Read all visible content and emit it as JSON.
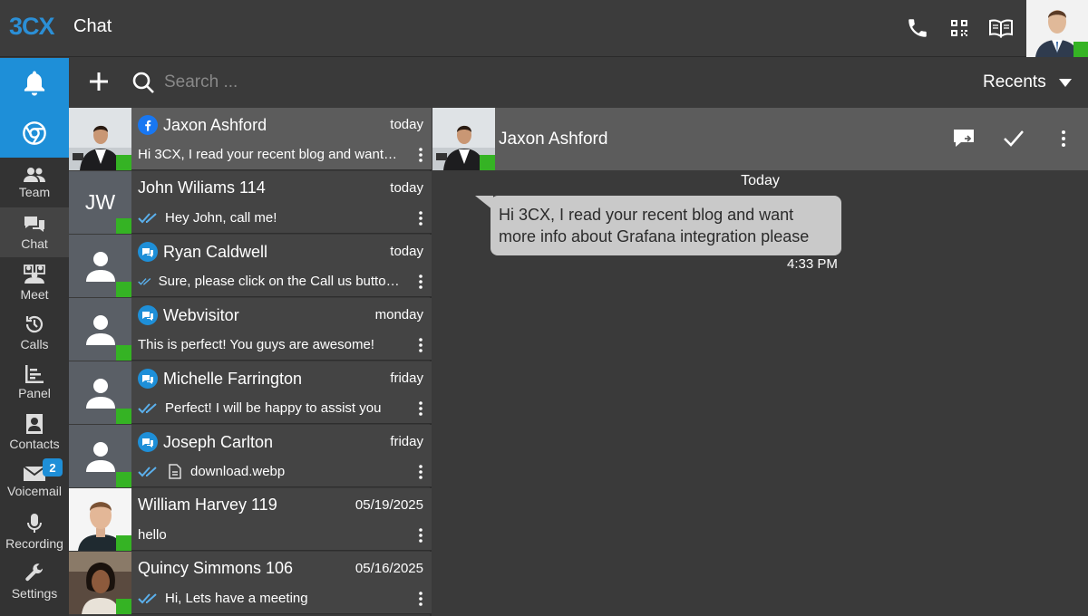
{
  "app": {
    "brand_left": "3",
    "brand_right": "CX",
    "title": "Chat"
  },
  "header_icons": [
    "phone-icon",
    "qr-code-icon",
    "book-icon"
  ],
  "nav": {
    "items": [
      {
        "label": "Team",
        "icon": "team-icon"
      },
      {
        "label": "Chat",
        "icon": "chat-icon"
      },
      {
        "label": "Meet",
        "icon": "meet-icon"
      },
      {
        "label": "Calls",
        "icon": "history-icon"
      },
      {
        "label": "Panel",
        "icon": "panel-icon"
      },
      {
        "label": "Contacts",
        "icon": "contacts-icon"
      },
      {
        "label": "Voicemail",
        "icon": "mail-icon",
        "badge": "2"
      },
      {
        "label": "Recording",
        "icon": "mic-icon"
      },
      {
        "label": "Settings",
        "icon": "wrench-icon"
      }
    ]
  },
  "toolbar": {
    "search_placeholder": "Search ...",
    "sort_label": "Recents"
  },
  "chats": [
    {
      "name": "Jaxon Ashford",
      "date": "today",
      "message": "Hi 3CX, I read your recent blog and want more info about Grafana integration please",
      "channel": "facebook",
      "avatar": "photo-man-suit",
      "ticks": false
    },
    {
      "name": "John Wiliams 114",
      "date": "today",
      "message": "Hey John, call me!",
      "channel": "none",
      "avatar": "initials",
      "initials": "JW",
      "ticks": true
    },
    {
      "name": "Ryan Caldwell",
      "date": "today",
      "message": "Sure, please click on the Call us button in the chat window",
      "channel": "livechat",
      "avatar": "placeholder",
      "ticks": true
    },
    {
      "name": "Webvisitor",
      "date": "monday",
      "message": "This is perfect! You guys are awesome!",
      "channel": "livechat",
      "avatar": "placeholder",
      "ticks": false
    },
    {
      "name": "Michelle Farrington",
      "date": "friday",
      "message": "Perfect! I will be happy to assist you",
      "channel": "livechat",
      "avatar": "placeholder",
      "ticks": true
    },
    {
      "name": "Joseph Carlton",
      "date": "friday",
      "message": "download.webp",
      "channel": "livechat",
      "avatar": "placeholder",
      "ticks": true,
      "file": true
    },
    {
      "name": "William Harvey 119",
      "date": "05/19/2025",
      "message": "hello",
      "channel": "none",
      "avatar": "photo-man",
      "ticks": false
    },
    {
      "name": "Quincy Simmons 106",
      "date": "05/16/2025",
      "message": "Hi, Lets have a meeting",
      "channel": "none",
      "avatar": "photo-woman",
      "ticks": true
    }
  ],
  "conversation": {
    "name": "Jaxon Ashford",
    "day_label": "Today",
    "messages": [
      {
        "text": "Hi 3CX, I read your recent blog and want more info about Grafana integration please",
        "time": "4:33 PM"
      }
    ]
  },
  "colors": {
    "accent": "#1e8fd8",
    "status_online": "#35b324",
    "bubble": "#c9c9c9"
  }
}
